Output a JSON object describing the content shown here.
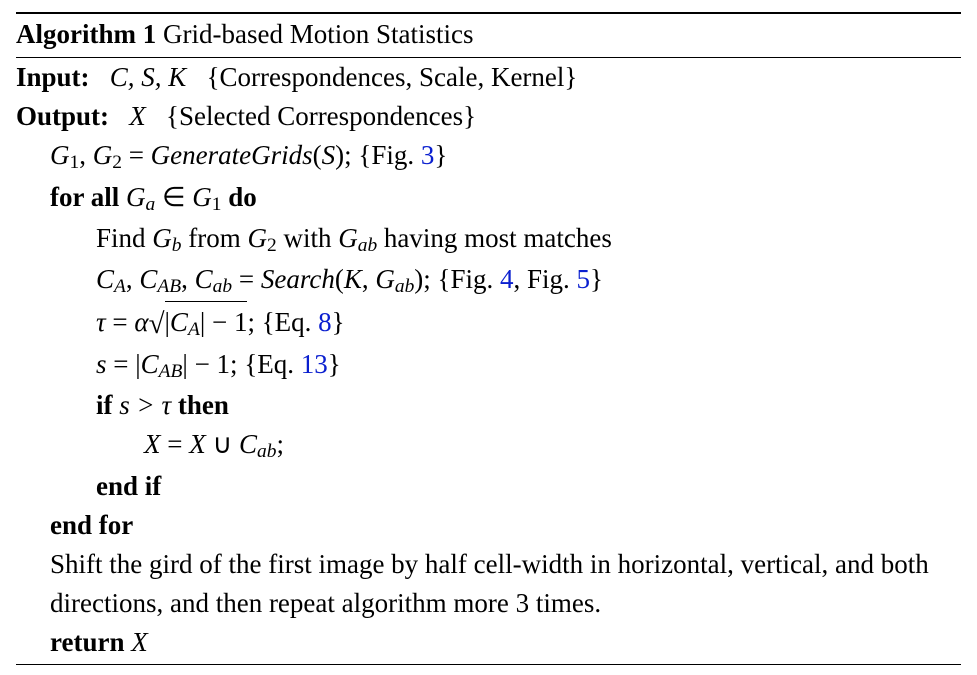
{
  "header": {
    "algo_label": "Algorithm 1",
    "title": "Grid-based Motion Statistics"
  },
  "io": {
    "input_label": "Input:",
    "input_vars": "C, S, K",
    "input_desc": "{Correspondences, Scale, Kernel}",
    "output_label": "Output:",
    "output_vars": "X",
    "output_desc": "{Selected Correspondences}"
  },
  "lines": {
    "l1_lhs1": "G",
    "l1_sub1": "1",
    "l1_comma": ", ",
    "l1_lhs2": "G",
    "l1_sub2": "2",
    "l1_eq": " = ",
    "l1_fn": "GenerateGrids",
    "l1_arg_open": "(",
    "l1_arg": "S",
    "l1_arg_close": ");",
    "l1_ref_open": " {Fig. ",
    "l1_ref": "3",
    "l1_ref_close": "}",
    "l2_for": "for all ",
    "l2_var": "G",
    "l2_sub": "a",
    "l2_in": " ∈ ",
    "l2_set": "G",
    "l2_setsub": "1",
    "l2_do": " do",
    "l3_a": "Find ",
    "l3_Gb": "G",
    "l3_Gb_sub": "b",
    "l3_b": " from ",
    "l3_G2": "G",
    "l3_G2_sub": "2",
    "l3_c": " with ",
    "l3_Gab": "G",
    "l3_Gab_sub": "ab",
    "l3_d": " having most matches",
    "l4_CA": "C",
    "l4_CA_sub": "A",
    "l4_c1": ", ",
    "l4_CAB": "C",
    "l4_CAB_sub": "AB",
    "l4_c2": ", ",
    "l4_Cab": "C",
    "l4_Cab_sub": "ab",
    "l4_eq": " = ",
    "l4_fn": "Search",
    "l4_open": "(",
    "l4_K": "K",
    "l4_comma": ", ",
    "l4_Gab": "G",
    "l4_Gab_sub": "ab",
    "l4_close": ");",
    "l4_ref_open": " {Fig. ",
    "l4_ref1": "4",
    "l4_ref_mid": ", Fig. ",
    "l4_ref2": "5",
    "l4_ref_close": "}",
    "l5_tau": "τ",
    "l5_eq": " = ",
    "l5_alpha": "α",
    "l5_bar_open": "|",
    "l5_CA": "C",
    "l5_CA_sub": "A",
    "l5_bar_close": "| − 1",
    "l5_semi": ";",
    "l5_ref_open": " {Eq. ",
    "l5_ref": "8",
    "l5_ref_close": "}",
    "l6_s": "s",
    "l6_eq": " = |",
    "l6_CAB": "C",
    "l6_CAB_sub": "AB",
    "l6_rest": "| − 1;",
    "l6_ref_open": " {Eq. ",
    "l6_ref": "13",
    "l6_ref_close": "}",
    "l7_if": "if ",
    "l7_s": "s",
    "l7_gt": " > ",
    "l7_tau": "τ",
    "l7_then": " then",
    "l8_X": "X",
    "l8_eq": " = ",
    "l8_X2": "X",
    "l8_cup": " ∪ ",
    "l8_Cab": "C",
    "l8_Cab_sub": "ab",
    "l8_semi": ";",
    "l9": "end if",
    "l10": "end for",
    "l11": "Shift the gird of the first image by half cell-width in horizontal, vertical, and both directions, and then repeat algorithm more 3 times.",
    "l12_ret": "return ",
    "l12_var": "X"
  }
}
